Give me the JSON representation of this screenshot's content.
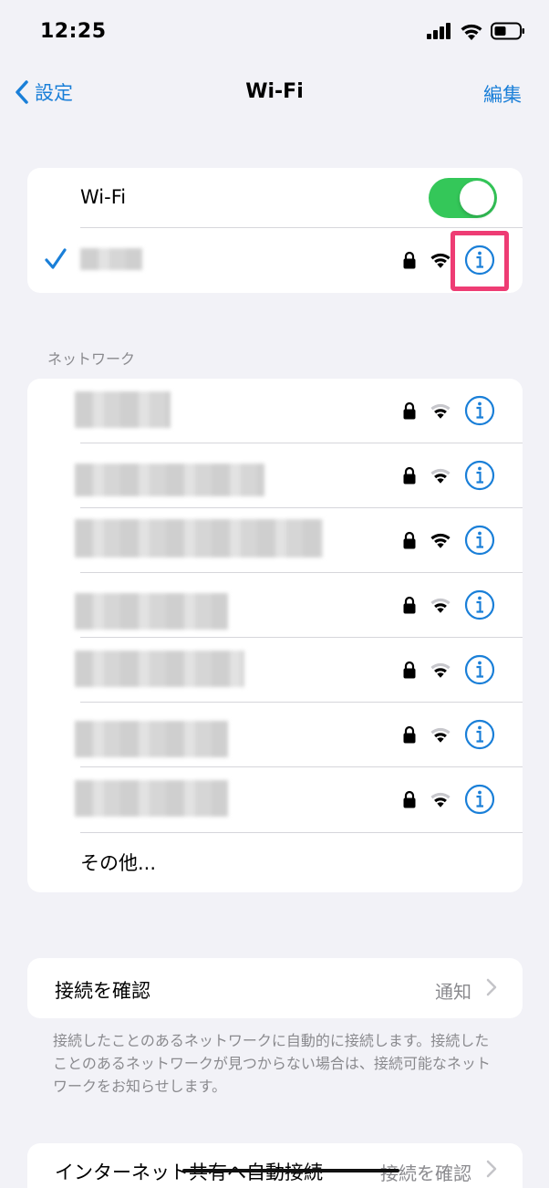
{
  "status_bar": {
    "time": "12:25"
  },
  "nav": {
    "back_label": "設定",
    "title": "Wi-Fi",
    "edit_label": "編集"
  },
  "wifi_section": {
    "label": "Wi-Fi",
    "toggle_on": true
  },
  "networks_section": {
    "header": "ネットワーク",
    "other_label": "その他..."
  },
  "confirm_join": {
    "label": "接続を確認",
    "value": "通知"
  },
  "footer_note": "接続したことのあるネットワークに自動的に接続します。接続したことのあるネットワークが見つからない場合は、接続可能なネットワークをお知らせします。",
  "hotspot_join": {
    "label": "インターネット共有へ自動接続",
    "value": "接続を確認"
  },
  "colors": {
    "accent": "#1a7fd8",
    "toggle": "#34c759",
    "highlight": "#ee3c74"
  }
}
